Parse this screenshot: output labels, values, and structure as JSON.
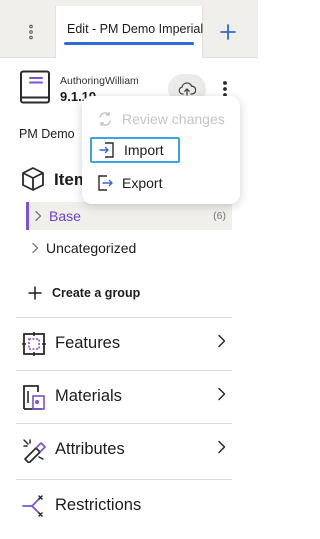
{
  "tabs": {
    "active_label": "Edit - PM Demo Imperial",
    "menu_icon": "vertical-dots-icon",
    "add_icon": "plus-icon"
  },
  "header": {
    "author": "AuthoringWilliam",
    "version": "9.1.19",
    "model_name": "PM Demo Imperial"
  },
  "dropdown": {
    "review": "Review changes",
    "import": "Import",
    "export": "Export"
  },
  "items": {
    "title": "Items",
    "tree": [
      {
        "label": "Base",
        "count": "(6)"
      },
      {
        "label": "Uncategorized"
      }
    ],
    "create_group": "Create a group"
  },
  "sections": [
    {
      "label": "Features",
      "icon": "features-icon"
    },
    {
      "label": "Materials",
      "icon": "materials-icon"
    },
    {
      "label": "Attributes",
      "icon": "attributes-icon"
    },
    {
      "label": "Restrictions",
      "icon": "restrictions-icon"
    }
  ],
  "colors": {
    "accent_blue": "#2d6bd9",
    "accent_purple": "#6a41d1",
    "focus_outline": "#3aa5e0",
    "tab_bar_bg": "#f1efec"
  }
}
